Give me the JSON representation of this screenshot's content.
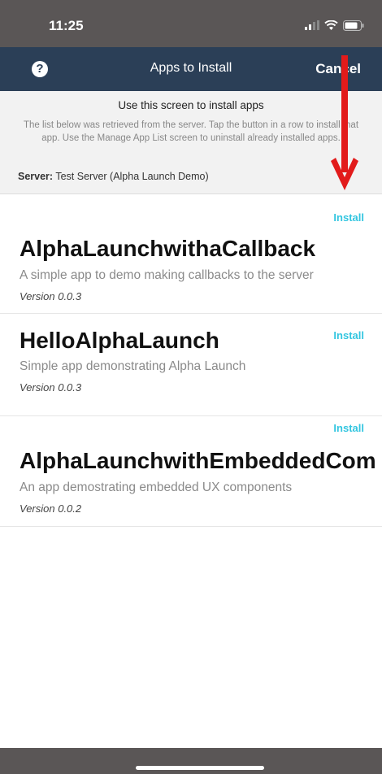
{
  "status_bar": {
    "time": "11:25"
  },
  "nav": {
    "title": "Apps to Install",
    "cancel_label": "Cancel",
    "help_label": "?"
  },
  "info": {
    "heading": "Use this screen to install apps",
    "body": "The list below was retrieved from the server. Tap the button in a row to install that app. Use the Manage App List screen to uninstall already installed apps.",
    "server_label": "Server:",
    "server_value": "Test Server (Alpha Launch Demo)"
  },
  "apps": [
    {
      "name": "AlphaLaunchwithaCallback",
      "description": "A simple app to demo making callbacks to the server",
      "version": "Version 0.0.3",
      "install_label": "Install"
    },
    {
      "name": "HelloAlphaLaunch",
      "description": "Simple app demonstrating Alpha Launch",
      "version": "Version 0.0.3",
      "install_label": "Install"
    },
    {
      "name": "AlphaLaunchwithEmbeddedCom",
      "description": "An app demostrating embedded UX components",
      "version": "Version 0.0.2",
      "install_label": "Install"
    }
  ],
  "colors": {
    "nav": "#2b3f57",
    "accent": "#33c6e0",
    "arrow": "#e21b1b"
  },
  "icons": [
    "help-icon",
    "signal-icon",
    "wifi-icon",
    "battery-icon",
    "down-arrow-annotation"
  ]
}
